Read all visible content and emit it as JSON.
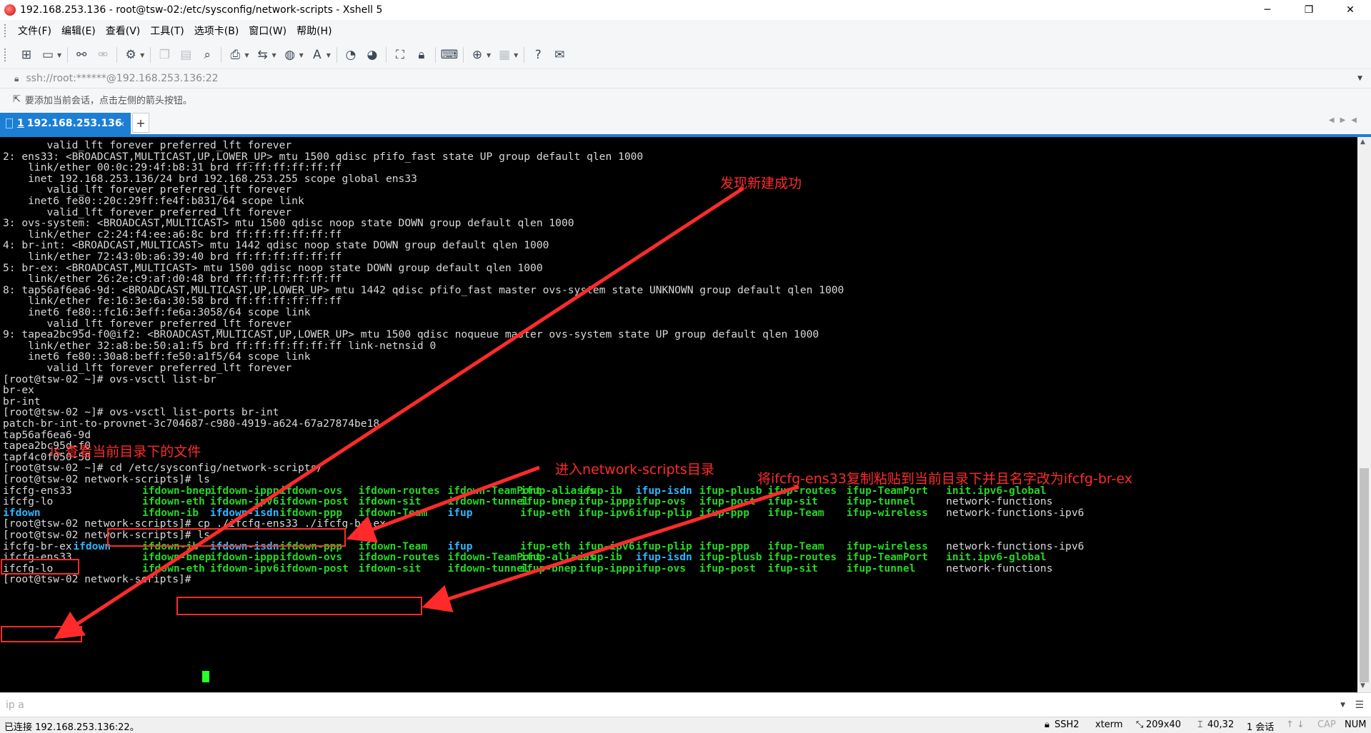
{
  "window": {
    "title": "192.168.253.136 - root@tsw-02:/etc/sysconfig/network-scripts - Xshell 5",
    "app_icon": "xshell-logo",
    "controls": [
      "─",
      "❐",
      "✕"
    ]
  },
  "menu": [
    "文件(F)",
    "编辑(E)",
    "查看(V)",
    "工具(T)",
    "选项卡(B)",
    "窗口(W)",
    "帮助(H)"
  ],
  "toolbar_icons": [
    "new-session",
    "open-folder",
    "reconnect",
    "disconnect",
    "properties",
    "copy",
    "paste",
    "find",
    "print",
    "transfer",
    "globe",
    "font",
    "xftp",
    "xmanager",
    "fullscreen",
    "lock",
    "keyboard",
    "add-tab",
    "layout",
    "help",
    "chat"
  ],
  "address": {
    "text": "ssh://root:******@192.168.253.136:22"
  },
  "hint": {
    "text": "要添加当前会话，点击左侧的箭头按钮。"
  },
  "tabs": [
    {
      "number": "1",
      "label": "192.168.253.136",
      "close": "×"
    }
  ],
  "tab_add": "+",
  "terminal": {
    "lines": [
      [
        [
          "",
          "       valid_lft forever preferred_lft forever"
        ]
      ],
      [
        [
          "",
          "2: ens33: <BROADCAST,MULTICAST,UP,LOWER_UP> mtu 1500 qdisc pfifo_fast state UP group default qlen 1000"
        ]
      ],
      [
        [
          "",
          "    link/ether 00:0c:29:4f:b8:31 brd ff:ff:ff:ff:ff:ff"
        ]
      ],
      [
        [
          "",
          "    inet 192.168.253.136/24 brd 192.168.253.255 scope global ens33"
        ]
      ],
      [
        [
          "",
          "       valid_lft forever preferred_lft forever"
        ]
      ],
      [
        [
          "",
          "    inet6 fe80::20c:29ff:fe4f:b831/64 scope link"
        ]
      ],
      [
        [
          "",
          "       valid_lft forever preferred_lft forever"
        ]
      ],
      [
        [
          "",
          "3: ovs-system: <BROADCAST,MULTICAST> mtu 1500 qdisc noop state DOWN group default qlen 1000"
        ]
      ],
      [
        [
          "",
          "    link/ether c2:24:f4:ee:a6:8c brd ff:ff:ff:ff:ff:ff"
        ]
      ],
      [
        [
          "",
          "4: br-int: <BROADCAST,MULTICAST> mtu 1442 qdisc noop state DOWN group default qlen 1000"
        ]
      ],
      [
        [
          "",
          "    link/ether 72:43:0b:a6:39:40 brd ff:ff:ff:ff:ff:ff"
        ]
      ],
      [
        [
          "",
          "5: br-ex: <BROADCAST,MULTICAST> mtu 1500 qdisc noop state DOWN group default qlen 1000"
        ]
      ],
      [
        [
          "",
          "    link/ether 26:2e:c9:af:d0:48 brd ff:ff:ff:ff:ff:ff"
        ]
      ],
      [
        [
          "",
          "8: tap56af6ea6-9d: <BROADCAST,MULTICAST,UP,LOWER_UP> mtu 1442 qdisc pfifo_fast master ovs-system state UNKNOWN group default qlen 1000"
        ]
      ],
      [
        [
          "",
          "    link/ether fe:16:3e:6a:30:58 brd ff:ff:ff:ff:ff:ff"
        ]
      ],
      [
        [
          "",
          "    inet6 fe80::fc16:3eff:fe6a:3058/64 scope link"
        ]
      ],
      [
        [
          "",
          "       valid_lft forever preferred_lft forever"
        ]
      ],
      [
        [
          "",
          "9: tapea2bc95d-f0@if2: <BROADCAST,MULTICAST,UP,LOWER_UP> mtu 1500 qdisc noqueue master ovs-system state UP group default qlen 1000"
        ]
      ],
      [
        [
          "",
          "    link/ether 32:a8:be:50:a1:f5 brd ff:ff:ff:ff:ff:ff link-netnsid 0"
        ]
      ],
      [
        [
          "",
          "    inet6 fe80::30a8:beff:fe50:a1f5/64 scope link"
        ]
      ],
      [
        [
          "",
          "       valid_lft forever preferred_lft forever"
        ]
      ],
      [
        [
          "",
          "[root@tsw-02 ~]# ovs-vsctl list-br"
        ]
      ],
      [
        [
          "",
          "br-ex"
        ]
      ],
      [
        [
          "",
          "br-int"
        ]
      ],
      [
        [
          "",
          "[root@tsw-02 ~]# ovs-vsctl list-ports br-int"
        ]
      ],
      [
        [
          "",
          "patch-br-int-to-provnet-3c704687-c980-4919-a624-67a27874be18"
        ]
      ],
      [
        [
          "",
          "tap56af6ea6-9d"
        ]
      ],
      [
        [
          "",
          "tapea2bc95d-f0"
        ]
      ],
      [
        [
          "",
          "tapf4c0f050-58"
        ]
      ],
      [
        [
          "",
          "[root@tsw-02 ~]# cd /etc/sysconfig/network-scripts/"
        ]
      ],
      [
        [
          "",
          "[root@tsw-02 network-scripts]# ls"
        ]
      ],
      [
        [
          "w",
          "ifcfg-ens33"
        ],
        [
          "g",
          "ifdown-bnep"
        ],
        [
          "g",
          "ifdown-ippp"
        ],
        [
          "g",
          "ifdown-ovs"
        ],
        [
          "g",
          "ifdown-routes"
        ],
        [
          "g",
          "ifdown-TeamPort"
        ],
        [
          "g",
          "ifup-aliases"
        ],
        [
          "g",
          "ifup-ib"
        ],
        [
          "c",
          "ifup-isdn"
        ],
        [
          "g",
          "ifup-plusb"
        ],
        [
          "g",
          "ifup-routes"
        ],
        [
          "g",
          "ifup-TeamPort"
        ],
        [
          "g",
          "init.ipv6-global"
        ]
      ],
      [
        [
          "w",
          "ifcfg-lo"
        ],
        [
          "g",
          "ifdown-eth"
        ],
        [
          "g",
          "ifdown-ipv6"
        ],
        [
          "g",
          "ifdown-post"
        ],
        [
          "g",
          "ifdown-sit"
        ],
        [
          "g",
          "ifdown-tunnel"
        ],
        [
          "g",
          "ifup-bnep"
        ],
        [
          "g",
          "ifup-ippp"
        ],
        [
          "g",
          "ifup-ovs"
        ],
        [
          "g",
          "ifup-post"
        ],
        [
          "g",
          "ifup-sit"
        ],
        [
          "g",
          "ifup-tunnel"
        ],
        [
          "w",
          "network-functions"
        ]
      ],
      [
        [
          "c",
          "ifdown"
        ],
        [
          "g",
          "ifdown-ib"
        ],
        [
          "c",
          "ifdown-isdn"
        ],
        [
          "g",
          "ifdown-ppp"
        ],
        [
          "g",
          "ifdown-Team"
        ],
        [
          "c",
          "ifup"
        ],
        [
          "g",
          "ifup-eth"
        ],
        [
          "g",
          "ifup-ipv6"
        ],
        [
          "g",
          "ifup-plip"
        ],
        [
          "g",
          "ifup-ppp"
        ],
        [
          "g",
          "ifup-Team"
        ],
        [
          "g",
          "ifup-wireless"
        ],
        [
          "w",
          "network-functions-ipv6"
        ]
      ],
      [
        [
          "",
          "[root@tsw-02 network-scripts]# cp ./ifcfg-ens33 ./ifcfg-br-ex"
        ]
      ],
      [
        [
          "",
          "[root@tsw-02 network-scripts]# ls"
        ]
      ],
      [
        [
          "w",
          "ifcfg-br-ex"
        ],
        [
          "c",
          "ifdown"
        ],
        [
          "g",
          "ifdown-ib"
        ],
        [
          "c",
          "ifdown-isdn"
        ],
        [
          "g",
          "ifdown-ppp"
        ],
        [
          "g",
          "ifdown-Team"
        ],
        [
          "c",
          "ifup"
        ],
        [
          "g",
          "ifup-eth"
        ],
        [
          "g",
          "ifup-ipv6"
        ],
        [
          "g",
          "ifup-plip"
        ],
        [
          "g",
          "ifup-ppp"
        ],
        [
          "g",
          "ifup-Team"
        ],
        [
          "g",
          "ifup-wireless"
        ],
        [
          "w",
          "network-functions-ipv6"
        ]
      ],
      [
        [
          "w",
          "ifcfg-ens33"
        ],
        [
          "g",
          "ifdown-bnep"
        ],
        [
          "g",
          "ifdown-ippp"
        ],
        [
          "g",
          "ifdown-ovs"
        ],
        [
          "g",
          "ifdown-routes"
        ],
        [
          "g",
          "ifdown-TeamPort"
        ],
        [
          "g",
          "ifup-aliases"
        ],
        [
          "g",
          "ifup-ib"
        ],
        [
          "c",
          "ifup-isdn"
        ],
        [
          "g",
          "ifup-plusb"
        ],
        [
          "g",
          "ifup-routes"
        ],
        [
          "g",
          "ifup-TeamPort"
        ],
        [
          "g",
          "init.ipv6-global"
        ]
      ],
      [
        [
          "w",
          "ifcfg-lo"
        ],
        [
          "g",
          "ifdown-eth"
        ],
        [
          "g",
          "ifdown-ipv6"
        ],
        [
          "g",
          "ifdown-post"
        ],
        [
          "g",
          "ifdown-sit"
        ],
        [
          "g",
          "ifdown-tunnel"
        ],
        [
          "g",
          "ifup-bnep"
        ],
        [
          "g",
          "ifup-ippp"
        ],
        [
          "g",
          "ifup-ovs"
        ],
        [
          "g",
          "ifup-post"
        ],
        [
          "g",
          "ifup-sit"
        ],
        [
          "g",
          "ifup-tunnel"
        ],
        [
          "w",
          "network-functions"
        ]
      ],
      [
        [
          "",
          "[root@tsw-02 network-scripts]# "
        ]
      ]
    ]
  },
  "annotations": {
    "found_success": "发现新建成功",
    "ls_files": "ls 查看当前目录下的文件",
    "enter_dir": "进入network-scripts目录",
    "copy_rename": "将ifcfg-ens33复制粘贴到当前目录下并且名字改为ifcfg-br-ex"
  },
  "command_bar": {
    "text": "ip a"
  },
  "status": {
    "connected": "已连接 192.168.253.136:22。",
    "protocol": "SSH2",
    "terminal_type": "xterm",
    "size": "209x40",
    "cursor_pos": "40,32",
    "sessions": "1 会话",
    "cap": "CAP",
    "num": "NUM"
  },
  "colors": {
    "accent": "#1c7fd4",
    "annotation": "#ff2b2b",
    "ls_exec": "#26d626",
    "ls_dir": "#2db6ff",
    "terminal_bg": "#000000"
  }
}
